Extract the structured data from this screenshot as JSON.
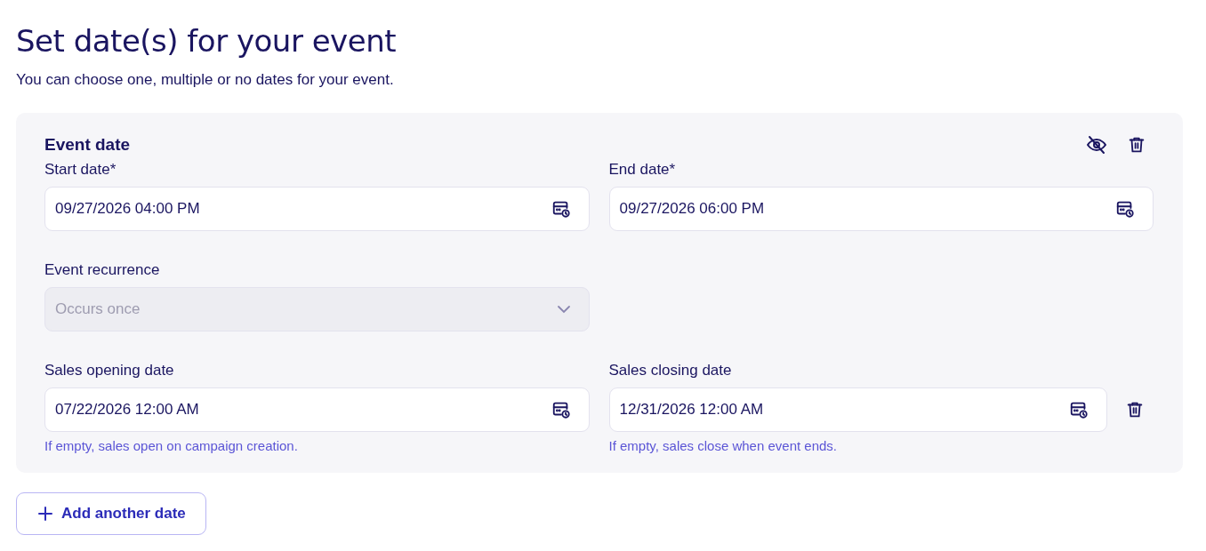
{
  "title": "Set date(s) for your event",
  "subtitle": "You can choose one, multiple or no dates for your event.",
  "card": {
    "title": "Event date",
    "hidden": false,
    "rows": [
      [
        {
          "kind": "date",
          "label": "Start date*",
          "value": "09/27/2026 04:00 PM",
          "disabled": false
        },
        {
          "kind": "date",
          "label": "End date*",
          "value": "09/27/2026 06:00 PM",
          "disabled": false
        }
      ],
      [
        {
          "kind": "select",
          "label": "Event recurrence",
          "value": "Occurs once",
          "disabled": true
        }
      ],
      [
        {
          "kind": "date",
          "label": "Sales opening date",
          "value": "07/22/2026 12:00 AM",
          "disabled": false,
          "hint": "If empty, sales open on campaign creation."
        },
        {
          "kind": "date",
          "label": "Sales closing date",
          "value": "12/31/2026 12:00 AM",
          "disabled": false,
          "hint": "If empty, sales close when event ends.",
          "removable": true
        }
      ]
    ]
  },
  "add_button": {
    "label": "Add another date"
  }
}
